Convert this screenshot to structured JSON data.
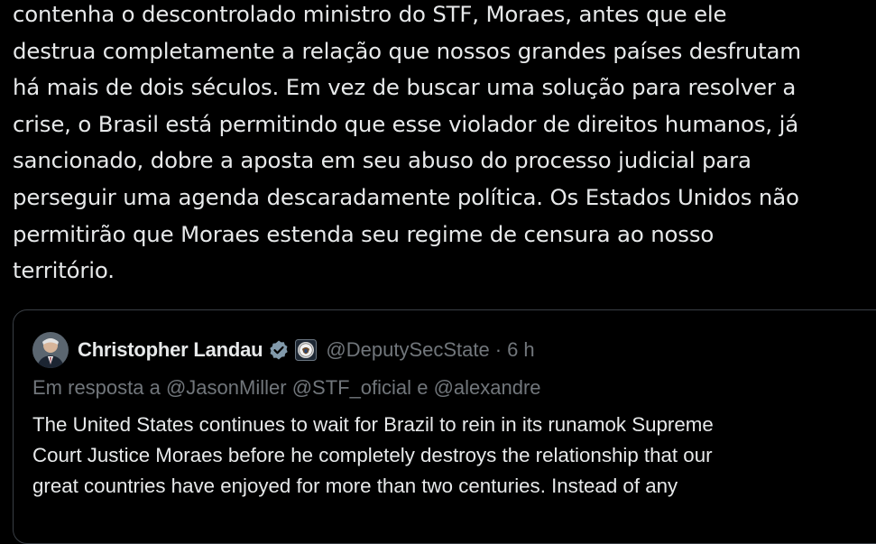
{
  "post": {
    "lines": [
      "contenha o descontrolado ministro do STF, Moraes, antes que ele",
      "destrua completamente a relação que nossos grandes países desfrutam",
      "há mais de dois séculos. Em vez de buscar uma solução para resolver a",
      "crise, o Brasil está permitindo que esse violador de direitos humanos, já",
      "sancionado, dobre a aposta em seu abuso do processo judicial para",
      "perseguir uma agenda descaradamente política. Os Estados Unidos não",
      "permitirão que Moraes estenda seu regime de censura ao nosso",
      "território."
    ]
  },
  "quote": {
    "author_name": "Christopher Landau",
    "handle": "@DeputySecState",
    "separator": "·",
    "time": "6 h",
    "reply_prefix": "Em resposta a",
    "reply_mentions": [
      "@JasonMiller",
      "@STF_oficial",
      "e",
      "@alexandre"
    ],
    "lines": [
      "The United States continues to wait for Brazil to rein in its runamok Supreme",
      "Court Justice Moraes before he completely destroys the relationship that our",
      "great countries have enjoyed for more than two centuries. Instead of any"
    ],
    "icons": {
      "verified": "verified-badge-icon",
      "affiliation": "state-department-seal-icon"
    }
  },
  "colors": {
    "background": "#000000",
    "text_primary": "#e7e9ea",
    "text_secondary": "#71767b",
    "border": "#3a3f45",
    "verified_badge": "#829aab"
  }
}
